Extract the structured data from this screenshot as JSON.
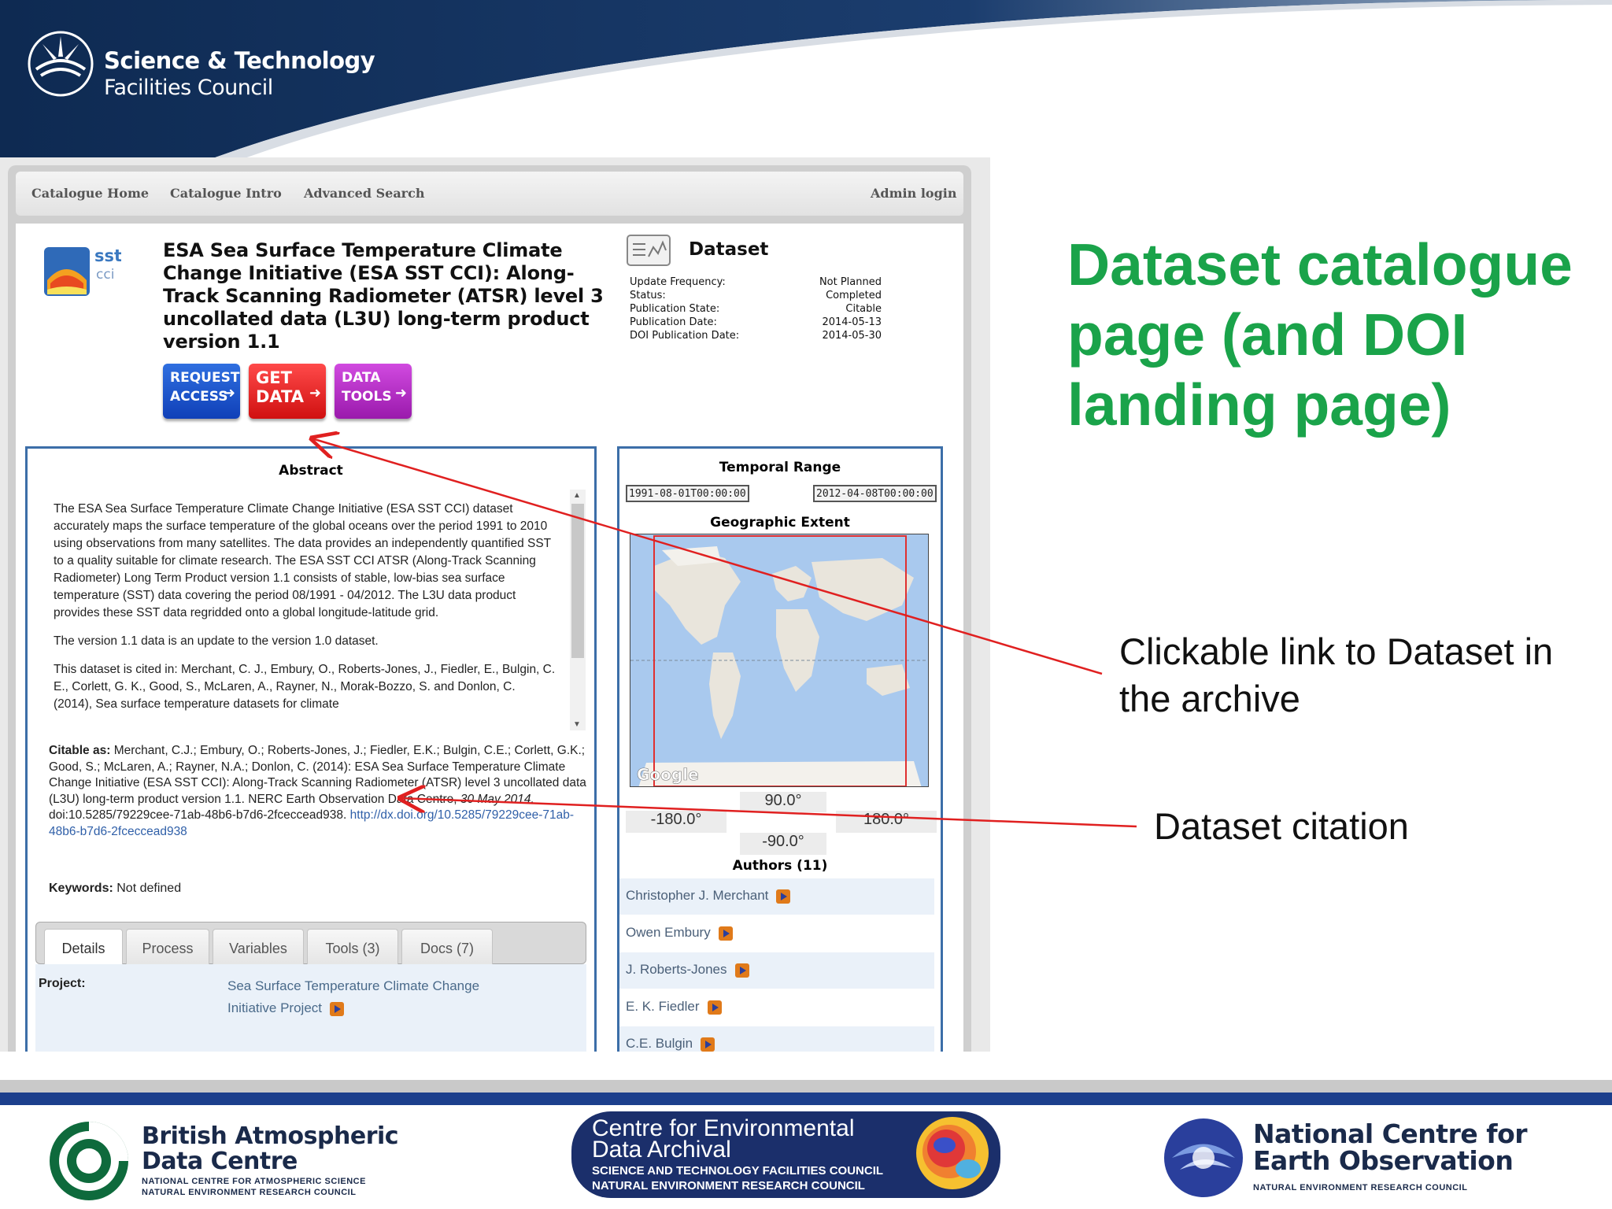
{
  "organisation": {
    "line1": "Science & Technology",
    "line2": "Facilities Council"
  },
  "catalogue": {
    "nav": {
      "home": "Catalogue Home",
      "intro": "Catalogue Intro",
      "advanced": "Advanced Search",
      "admin": "Admin login"
    },
    "logo_text": {
      "top": "sst",
      "bottom": "cci"
    },
    "title": "ESA Sea Surface Temperature Climate Change Initiative (ESA SST CCI): Along-Track Scanning Radiometer (ATSR) level 3 uncollated data (L3U) long-term product version 1.1",
    "buttons": {
      "request_1": "REQUEST",
      "request_2": "ACCESS",
      "get_1": "GET",
      "get_2": "DATA",
      "tools_1": "DATA",
      "tools_2": "TOOLS"
    },
    "dataset_heading": "Dataset",
    "meta": [
      {
        "label": "Update Frequency:",
        "value": "Not Planned"
      },
      {
        "label": "Status:",
        "value": "Completed"
      },
      {
        "label": "Publication State:",
        "value": "Citable"
      },
      {
        "label": "Publication Date:",
        "value": "2014-05-13"
      },
      {
        "label": "DOI Publication Date:",
        "value": "2014-05-30"
      }
    ],
    "abstract_title": "Abstract",
    "abstract": [
      "The ESA Sea Surface Temperature Climate Change Initiative (ESA SST CCI) dataset accurately maps the surface temperature of the global oceans over the period 1991 to 2010 using observations from many satellites. The data provides an independently quantified SST to a quality suitable for climate research. The ESA SST CCI ATSR (Along-Track Scanning Radiometer) Long Term Product version 1.1 consists of stable, low-bias sea surface temperature (SST) data covering the period 08/1991 - 04/2012. The L3U data product provides these SST data regridded onto a global longitude-latitude grid.",
      "The version 1.1 data is an update to the version 1.0 dataset.",
      "This dataset is cited in: Merchant, C. J., Embury, O., Roberts-Jones, J., Fiedler, E., Bulgin, C. E., Corlett, G. K., Good, S., McLaren, A., Rayner, N., Morak-Bozzo, S. and Donlon, C. (2014), Sea surface temperature datasets for climate"
    ],
    "citation": {
      "label": "Citable as:",
      "text": "Merchant, C.J.; Embury, O.; Roberts-Jones, J.; Fiedler, E.K.; Bulgin, C.E.; Corlett, G.K.; Good, S.; McLaren, A.; Rayner, N.A.; Donlon, C. (2014): ESA Sea Surface Temperature Climate Change Initiative (ESA SST CCI): Along-Track Scanning Radiometer (ATSR) level 3 uncollated data (L3U) long-term product version 1.1. NERC Earth Observation Data Centre,",
      "date": "30 May 2014.",
      "doi": "doi:10.5285/79229cee-71ab-48b6-b7d6-2fceccead938.",
      "url": "http://dx.doi.org/10.5285/79229cee-71ab-48b6-b7d6-2fceccead938"
    },
    "keywords": {
      "label": "Keywords:",
      "value": "Not defined"
    },
    "tabs": [
      "Details",
      "Process",
      "Variables",
      "Tools (3)",
      "Docs (7)"
    ],
    "project": {
      "label": "Project:",
      "value": "Sea Surface Temperature Climate Change Initiative Project"
    },
    "temporal_title": "Temporal Range",
    "temporal_start": "1991-08-01T00:00:00",
    "temporal_end": "2012-04-08T00:00:00",
    "geo_title": "Geographic Extent",
    "map_brand": "Google",
    "coords": {
      "north": "90.0°",
      "south": "-90.0°",
      "west": "-180.0°",
      "east": "180.0°"
    },
    "authors_title": "Authors (11)",
    "authors": [
      "Christopher J. Merchant",
      "Owen Embury",
      "J. Roberts-Jones",
      "E. K. Fiedler",
      "C.E. Bulgin"
    ]
  },
  "slide": {
    "title": "Dataset catalogue page (and DOI landing page)",
    "annotation_link": "Clickable link to Dataset in the archive",
    "annotation_citation": "Dataset citation",
    "arrow_color": "#e02020",
    "title_color": "#1aa34a"
  },
  "footer": {
    "badc": {
      "line1": "British Atmospheric",
      "line2": "Data Centre",
      "sub1": "NATIONAL CENTRE FOR ATMOSPHERIC SCIENCE",
      "sub2": "NATURAL ENVIRONMENT RESEARCH COUNCIL"
    },
    "ceda": {
      "line1": "Centre for Environmental",
      "line2": "Data Archival",
      "sub1": "SCIENCE AND TECHNOLOGY FACILITIES COUNCIL",
      "sub2": "NATURAL ENVIRONMENT RESEARCH COUNCIL"
    },
    "nceo": {
      "line1": "National Centre for",
      "line2": "Earth Observation",
      "sub": "NATURAL ENVIRONMENT RESEARCH COUNCIL"
    }
  }
}
